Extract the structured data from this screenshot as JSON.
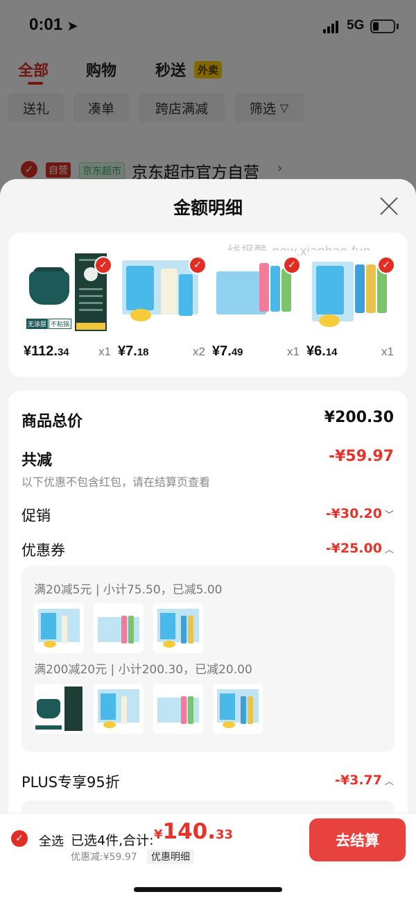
{
  "status_bar": {
    "time": "0:01",
    "network": "5G"
  },
  "background": {
    "tabs": [
      {
        "label": "全部"
      },
      {
        "label": "购物"
      },
      {
        "label": "秒送"
      }
    ],
    "waimai_badge": "外卖",
    "chips": [
      "送礼",
      "凑单",
      "跨店满减",
      "筛选"
    ],
    "store": {
      "self_badge": "自营",
      "super_badge": "京东超市",
      "name": "京东超市官方自营"
    }
  },
  "sheet": {
    "title": "金额明细",
    "watermark": "线报酷-new.xianbao.fun",
    "products": [
      {
        "price_int": "¥112.",
        "price_dec": "34",
        "qty": "x1",
        "thumb": "pot"
      },
      {
        "price_int": "¥7.",
        "price_dec": "18",
        "qty": "x2",
        "thumb": "ice-single"
      },
      {
        "price_int": "¥7.",
        "price_dec": "49",
        "qty": "x1",
        "thumb": "ice-box"
      },
      {
        "price_int": "¥6.",
        "price_dec": "14",
        "qty": "x1",
        "thumb": "ice-multi"
      }
    ],
    "summary": {
      "total_label": "商品总价",
      "total_value": "¥200.30",
      "discount_label": "共减",
      "discount_value": "-¥59.97",
      "discount_note": "以下优惠不包含红包，请在结算页查看",
      "promo_label": "促销",
      "promo_value": "-¥30.20",
      "coupon_label": "优惠券",
      "coupon_value": "-¥25.00",
      "coupon_groups": [
        {
          "text": "满20减5元 | 小计75.50，已减5.00",
          "items": [
            "ice-single",
            "ice-box",
            "ice-multi"
          ]
        },
        {
          "text": "满200减20元 | 小计200.30，已减20.00",
          "items": [
            "pot",
            "ice-single",
            "ice-box",
            "ice-multi"
          ]
        }
      ],
      "plus_label": "PLUS专享95折",
      "plus_value": "-¥3.77"
    }
  },
  "bottom_bar": {
    "select_all": "全选",
    "selected_text": "已选4件,合计:",
    "total_symbol": "¥",
    "total_int": "140.",
    "total_dec": "33",
    "saved": "优惠减:¥59.97",
    "detail_link": "优惠明细",
    "checkout": "去结算"
  },
  "colors": {
    "accent_red": "#e02e24",
    "price_red": "#e63329",
    "checkout_bg": "#e8423f"
  }
}
